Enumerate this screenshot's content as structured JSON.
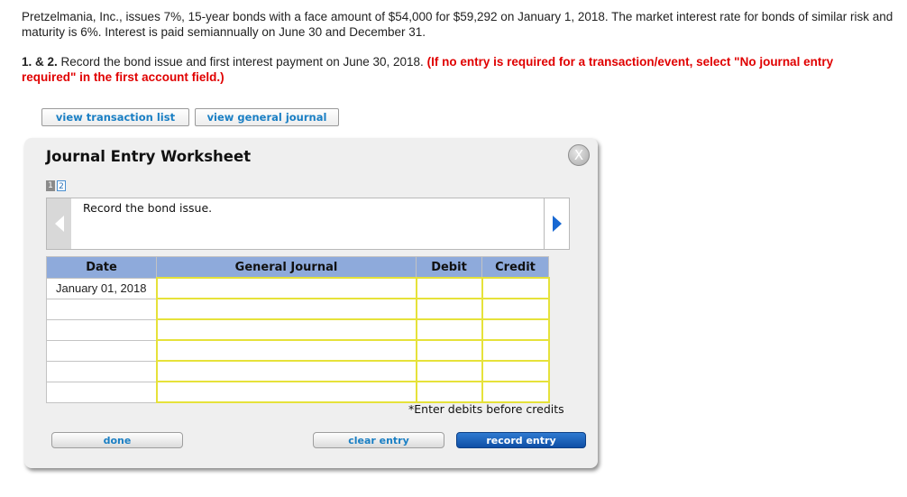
{
  "problem": {
    "text": "Pretzelmania, Inc., issues 7%, 15-year bonds with a face amount of $54,000 for $59,292 on January 1, 2018. The market interest rate for bonds of similar risk and maturity is 6%. Interest is paid semiannually on June 30 and December 31."
  },
  "instructions": {
    "number": "1. & 2.",
    "text": "Record the bond issue and first interest payment on June 30, 2018.",
    "red_note": "(If no entry is required for a transaction/event, select \"No journal entry required\" in the first account field.)"
  },
  "buttons": {
    "view_transaction_list": "view transaction list",
    "view_general_journal": "view general journal",
    "done": "done",
    "clear_entry": "clear entry",
    "record_entry": "record entry"
  },
  "worksheet": {
    "title": "Journal Entry Worksheet",
    "close_glyph": "X",
    "pages": [
      "1",
      "2"
    ],
    "description": "Record the bond issue.",
    "columns": {
      "date": "Date",
      "general_journal": "General Journal",
      "debit": "Debit",
      "credit": "Credit"
    },
    "rows": [
      {
        "date": "January 01, 2018"
      },
      {
        "date": ""
      },
      {
        "date": ""
      },
      {
        "date": ""
      },
      {
        "date": ""
      },
      {
        "date": ""
      }
    ],
    "note": "*Enter debits before credits"
  },
  "colors": {
    "header_bg": "#8eaadb",
    "input_border": "#e6e23a",
    "link_blue": "#1a7fc4",
    "red_text": "#e00000",
    "primary_button": "#1a5fb4"
  }
}
